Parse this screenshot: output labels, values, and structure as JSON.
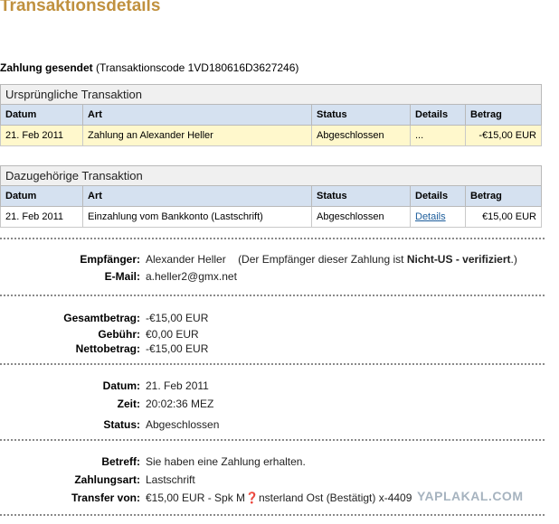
{
  "title": "Transaktionsdetails",
  "payment": {
    "status_label": "Zahlung gesendet",
    "code_text": "(Transaktionscode 1VD180616D3627246)"
  },
  "columns": [
    "Datum",
    "Art",
    "Status",
    "Details",
    "Betrag"
  ],
  "original": {
    "heading": "Ursprüngliche Transaktion",
    "row": {
      "date": "21. Feb 2011",
      "type": "Zahlung an Alexander Heller",
      "status": "Abgeschlossen",
      "details": "...",
      "amount": "-€15,00 EUR"
    }
  },
  "related": {
    "heading": "Dazugehörige Transaktion",
    "row": {
      "date": "21. Feb 2011",
      "type": "Einzahlung vom Bankkonto (Lastschrift)",
      "status": "Abgeschlossen",
      "details": "Details",
      "amount": "€15,00 EUR"
    }
  },
  "recipient": {
    "label": "Empfänger:",
    "name": "Alexander Heller",
    "note_pre": "(Der Empfänger dieser Zahlung ist ",
    "note_bold": "Nicht-US - verifiziert",
    "note_post": ".)",
    "email_label": "E-Mail:",
    "email": "a.heller2@gmx.net"
  },
  "amounts": {
    "gross_label": "Gesamtbetrag:",
    "gross": "-€15,00 EUR",
    "fee_label": "Gebühr:",
    "fee": "€0,00 EUR",
    "net_label": "Nettobetrag:",
    "net": "-€15,00 EUR"
  },
  "timing": {
    "date_label": "Datum:",
    "date": "21. Feb 2011",
    "time_label": "Zeit:",
    "time": "20:02:36 MEZ",
    "status_label": "Status:",
    "status": "Abgeschlossen"
  },
  "info": {
    "subject_label": "Betreff:",
    "subject": "Sie haben eine Zahlung erhalten.",
    "method_label": "Zahlungsart:",
    "method": "Lastschrift",
    "transfer_label": "Transfer von:",
    "transfer": "€15,00 EUR - Spk M❓nsterland Ost (Bestätigt) x-4409"
  },
  "watermark": "YAPLAKAL.COM"
}
